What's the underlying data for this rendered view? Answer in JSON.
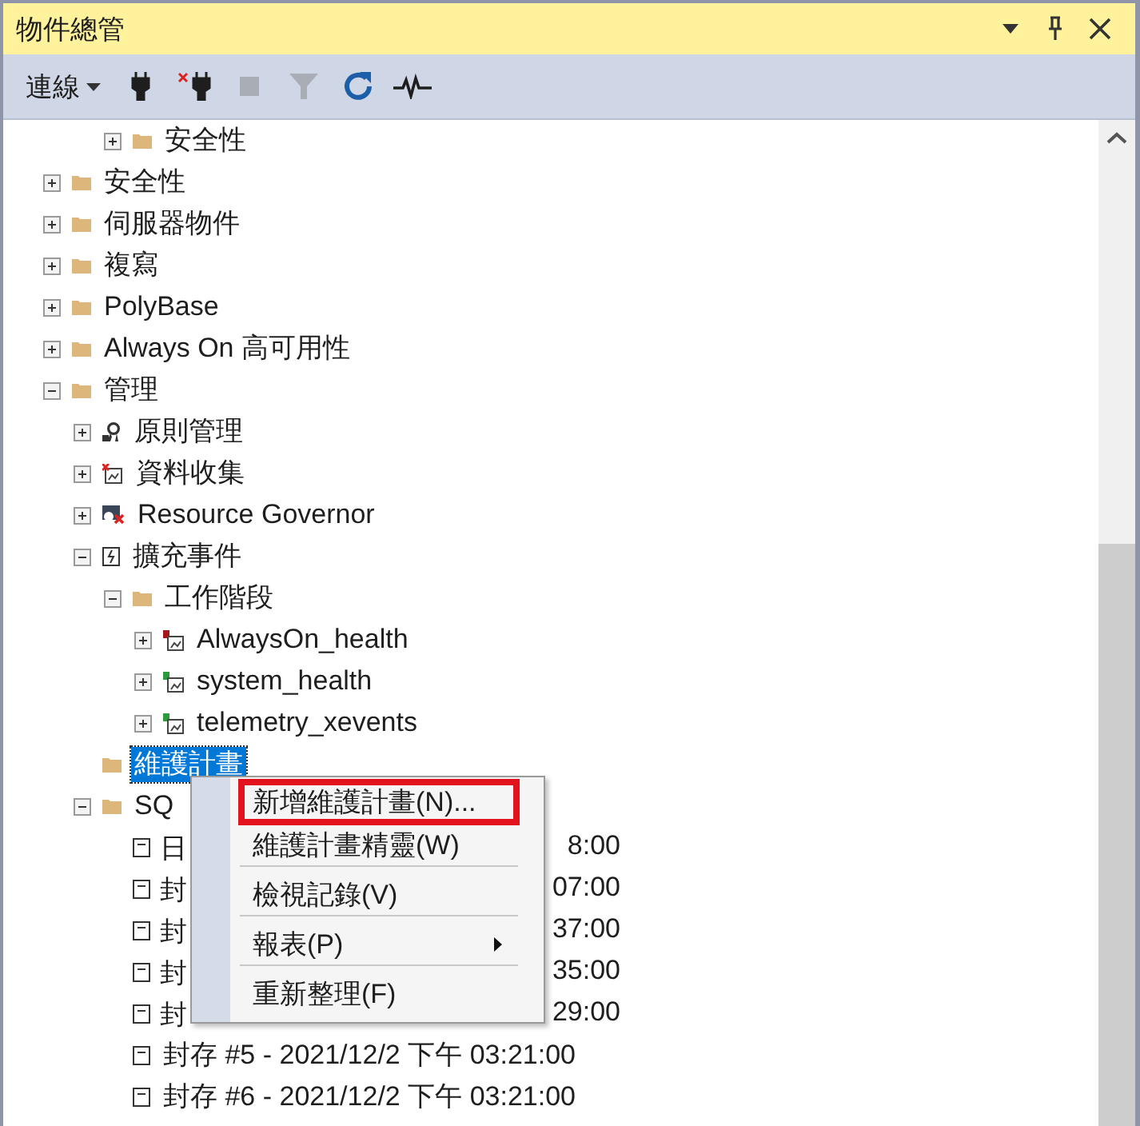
{
  "window": {
    "title": "物件總管",
    "controls": [
      {
        "kind": "dropdown"
      },
      {
        "kind": "pin"
      },
      {
        "kind": "close"
      }
    ]
  },
  "toolbar": {
    "connect_menu": {
      "label": "連線"
    },
    "buttons": [
      {
        "kind": "connect",
        "disabled": false
      },
      {
        "kind": "disconnect",
        "disabled": false
      },
      {
        "kind": "stop",
        "disabled": true
      },
      {
        "kind": "filter",
        "disabled": true
      },
      {
        "kind": "refresh",
        "disabled": false
      },
      {
        "kind": "activity",
        "disabled": false
      }
    ]
  },
  "tree": [
    {
      "children": [
        {
          "children": [
            {
              "label": "安全性",
              "kind": "folder",
              "expanded": false,
              "selected": false
            }
          ]
        }
      ]
    },
    {
      "label": "安全性",
      "kind": "folder",
      "expanded": false,
      "selected": false
    },
    {
      "label": "伺服器物件",
      "kind": "folder",
      "expanded": false,
      "selected": false
    },
    {
      "label": "複寫",
      "kind": "folder",
      "expanded": false,
      "selected": false
    },
    {
      "label": "PolyBase",
      "kind": "folder",
      "expanded": false,
      "selected": false
    },
    {
      "label": "Always On 高可用性",
      "kind": "folder",
      "expanded": false,
      "selected": false
    },
    {
      "label": "管理",
      "kind": "folder",
      "expanded": true,
      "selected": false,
      "children": [
        {
          "label": "原則管理",
          "kind": "policy",
          "expanded": false,
          "selected": false
        },
        {
          "label": "資料收集",
          "kind": "collector",
          "expanded": false,
          "selected": false
        },
        {
          "label": "Resource Governor",
          "kind": "governor",
          "expanded": false,
          "selected": false
        },
        {
          "label": "擴充事件",
          "kind": "xevents",
          "expanded": true,
          "selected": false,
          "children": [
            {
              "label": "工作階段",
              "kind": "folder",
              "expanded": true,
              "selected": false,
              "children": [
                {
                  "label": "AlwaysOn_health",
                  "kind": "session_stopped",
                  "expanded": false,
                  "selected": false
                },
                {
                  "label": "system_health",
                  "kind": "session_running",
                  "expanded": false,
                  "selected": false
                },
                {
                  "label": "telemetry_xevents",
                  "kind": "session_running",
                  "expanded": false,
                  "selected": false
                }
              ]
            }
          ]
        },
        {
          "label": "維護計畫",
          "kind": "folder",
          "selected": true
        },
        {
          "label": "SQ",
          "kind": "folder",
          "expanded": true,
          "selected": false,
          "children": [
            {
              "label_start": "日",
              "label_end": "8:00",
              "kind": "log",
              "selected": false
            },
            {
              "label_start": "封",
              "label_end": "07:00",
              "kind": "log",
              "selected": false
            },
            {
              "label_start": "封",
              "label_end": "37:00",
              "kind": "log",
              "selected": false
            },
            {
              "label_start": "封",
              "label_end": "35:00",
              "kind": "log",
              "selected": false
            },
            {
              "label_start": "封",
              "label_end": "29:00",
              "kind": "log",
              "selected": false
            },
            {
              "label": "封存 #5 - 2021/12/2 下午 03:21:00",
              "kind": "log",
              "selected": false
            },
            {
              "label": "封存 #6 - 2021/12/2 下午 03:21:00",
              "kind": "log",
              "selected": false
            }
          ]
        }
      ]
    }
  ],
  "context_menu": {
    "items": [
      {
        "label": "新增維護計畫(N)...",
        "highlighted": true,
        "submenu": false,
        "separator_after": false
      },
      {
        "label": "維護計畫精靈(W)",
        "highlighted": false,
        "submenu": false,
        "separator_after": true
      },
      {
        "label": "檢視記錄(V)",
        "highlighted": false,
        "submenu": false,
        "separator_after": true
      },
      {
        "label": "報表(P)",
        "highlighted": false,
        "submenu": true,
        "separator_after": true
      },
      {
        "label": "重新整理(F)",
        "highlighted": false,
        "submenu": false,
        "separator_after": false
      }
    ]
  }
}
